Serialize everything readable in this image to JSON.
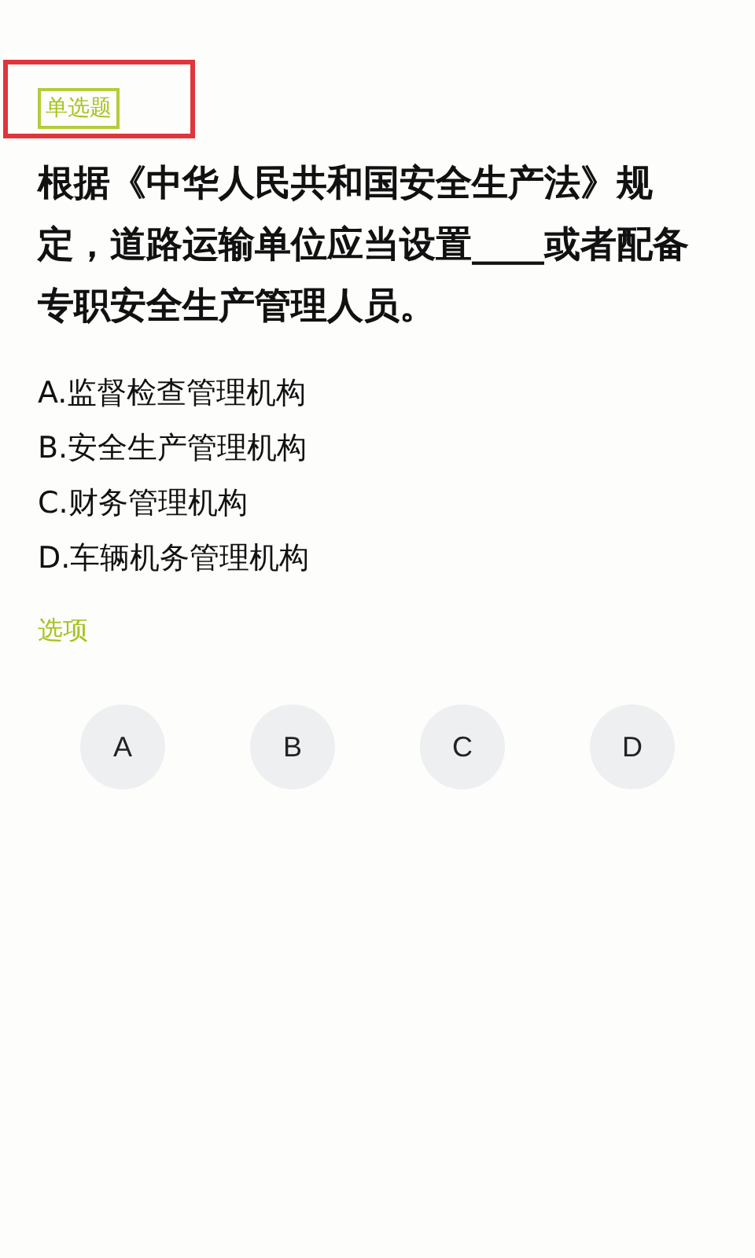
{
  "question_type": "单选题",
  "question": "根据《中华人民共和国安全生产法》规定，道路运输单位应当设置____或者配备专职安全生产管理人员。",
  "options": [
    "A.监督检查管理机构",
    "B.安全生产管理机构",
    "C.财务管理机构",
    "D.车辆机务管理机构"
  ],
  "answer_label": "选项",
  "answer_buttons": [
    {
      "label": "A",
      "selected": false
    },
    {
      "label": "B",
      "selected": false
    },
    {
      "label": "C",
      "selected": false
    },
    {
      "label": "D",
      "selected": false
    }
  ]
}
